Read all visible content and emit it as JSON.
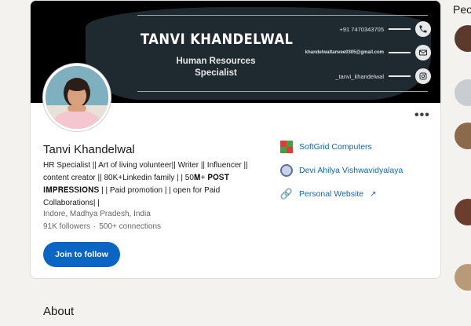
{
  "banner": {
    "name": "TANVI KHANDELWAL",
    "role_line1": "Human Resources",
    "role_line2": "Specialist",
    "phone": "+91 7470343705",
    "email": "khandelwaltanvee0305@gmail.com",
    "instagram": "_tanvi_khandelwal",
    "phone_icon": "phone-icon",
    "email_icon": "mail-icon",
    "instagram_icon": "instagram-icon"
  },
  "profile": {
    "name": "Tanvi Khandelwal",
    "headline_part1": "HR Specialist || Art of living volunteer|| Writer || Influencer || content creator || 80K+Linkedin family | | 50",
    "headline_bold": "𝐌+ 𝐏𝐎𝐒𝐓 𝐈𝐌𝐏𝐑𝐄𝐒𝐒𝐈𝐎𝐍𝐒",
    "headline_part2": " | | Paid promotion | | open for Paid Collaborations| |",
    "location": "Indore, Madhya Pradesh, India",
    "followers": "91K followers",
    "connections": "500+ connections",
    "follow_button": "Join to follow",
    "more_label": "•••"
  },
  "side_links": {
    "company": "SoftGrid Computers",
    "education": "Devi Ahilya Vishwavidyalaya",
    "website": "Personal Website",
    "website_icon": "external-link-icon"
  },
  "about": {
    "title": "About"
  },
  "right_rail": {
    "title": "Peo"
  },
  "colors": {
    "accent": "#0a66c2",
    "page_bg": "#f4f2ee",
    "banner_bg": "#1e2a30"
  }
}
